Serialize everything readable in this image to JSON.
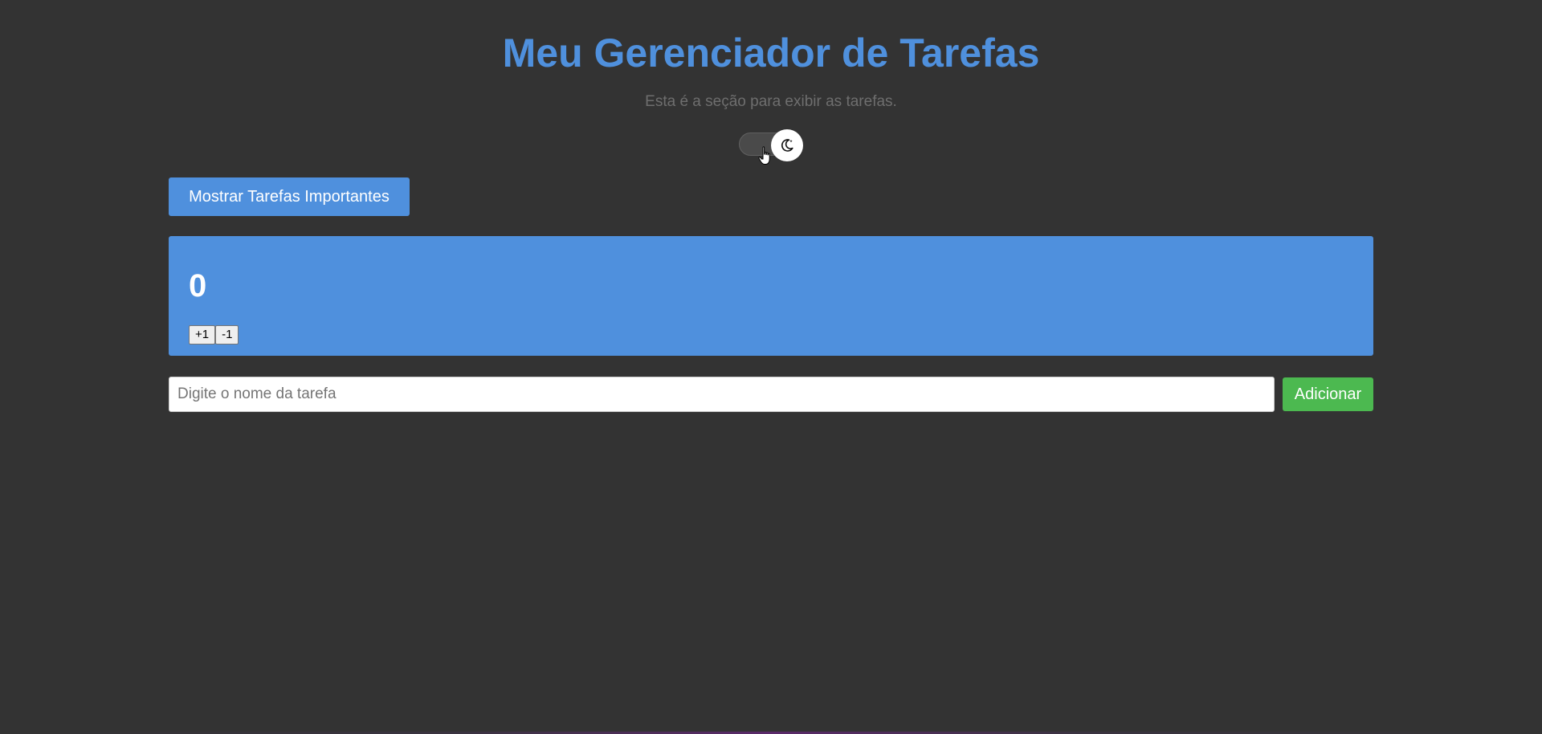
{
  "header": {
    "title": "Meu Gerenciador de Tarefas",
    "subtitle": "Esta é a seção para exibir as tarefas."
  },
  "theme_toggle": {
    "icon": "moon-icon",
    "state": "dark"
  },
  "controls": {
    "important_button_label": "Mostrar Tarefas Importantes"
  },
  "counter": {
    "value": "0",
    "increment_label": "+1",
    "decrement_label": "-1"
  },
  "task_form": {
    "input_value": "",
    "input_placeholder": "Digite o nome da tarefa",
    "add_label": "Adicionar"
  },
  "colors": {
    "background": "#333333",
    "accent": "#4f90dd",
    "add_button": "#4cb950",
    "subtitle": "#6e6e6e"
  }
}
